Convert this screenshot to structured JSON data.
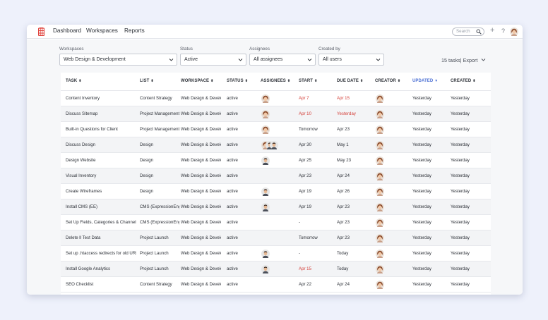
{
  "nav": {
    "items": [
      "Dashboard",
      "Workspaces",
      "Reports"
    ],
    "search_placeholder": "Search"
  },
  "filters": {
    "workspaces": {
      "label": "Workspaces",
      "value": "Web Design & Development"
    },
    "status": {
      "label": "Status",
      "value": "Active"
    },
    "assignees": {
      "label": "Assignees",
      "value": "All assignees"
    },
    "created_by": {
      "label": "Created by",
      "value": "All users"
    }
  },
  "summary": {
    "count_text": "15 tasks| Export"
  },
  "colors": {
    "accent": "#4a6fd4",
    "overdue": "#d4403a",
    "brand": "#e0443e"
  },
  "table": {
    "columns": [
      "TASK",
      "LIST",
      "WORKSPACE",
      "STATUS",
      "ASSIGNEES",
      "START",
      "DUE DATE",
      "CREATOR",
      "UPDATED",
      "CREATED"
    ],
    "sorted_column": "UPDATED",
    "rows": [
      {
        "task": "Content Inventory",
        "list": "Content Strategy",
        "workspace": "Web Design & Develo",
        "status": "active",
        "assignees": [
          "avatar-woman"
        ],
        "start": "Apr 7",
        "start_red": true,
        "due": "Apr 15",
        "due_red": true,
        "creator": "avatar-woman",
        "updated": "Yesterday",
        "created": "Yesterday"
      },
      {
        "task": "Discuss Sitemap",
        "list": "Project Management",
        "workspace": "Web Design & Develo",
        "status": "active",
        "assignees": [
          "avatar-woman"
        ],
        "start": "Apr 10",
        "start_red": true,
        "due": "Yesterday",
        "due_red": true,
        "creator": "avatar-woman",
        "updated": "Yesterday",
        "created": "Yesterday"
      },
      {
        "task": "Built-in Questions for Client",
        "list": "Project Management",
        "workspace": "Web Design & Develo",
        "status": "active",
        "assignees": [
          "avatar-woman"
        ],
        "start": "Tomorrow",
        "start_red": false,
        "due": "Apr 23",
        "due_red": false,
        "creator": "avatar-woman",
        "updated": "Yesterday",
        "created": "Yesterday"
      },
      {
        "task": "Discuss Design",
        "list": "Design",
        "workspace": "Web Design & Develo",
        "status": "active",
        "assignees": [
          "avatar-woman",
          "avatar-man",
          "avatar-man"
        ],
        "start": "Apr 30",
        "start_red": false,
        "due": "May 1",
        "due_red": false,
        "creator": "avatar-woman",
        "updated": "Yesterday",
        "created": "Yesterday"
      },
      {
        "task": "Design Website",
        "list": "Design",
        "workspace": "Web Design & Develo",
        "status": "active",
        "assignees": [
          "avatar-man"
        ],
        "start": "Apr 25",
        "start_red": false,
        "due": "May 23",
        "due_red": false,
        "creator": "avatar-woman",
        "updated": "Yesterday",
        "created": "Yesterday"
      },
      {
        "task": "Visual Inventory",
        "list": "Design",
        "workspace": "Web Design & Develo",
        "status": "active",
        "assignees": [],
        "start": "Apr 23",
        "start_red": false,
        "due": "Apr 24",
        "due_red": false,
        "creator": "avatar-woman",
        "updated": "Yesterday",
        "created": "Yesterday"
      },
      {
        "task": "Create Wireframes",
        "list": "Design",
        "workspace": "Web Design & Develo",
        "status": "active",
        "assignees": [
          "avatar-man"
        ],
        "start": "Apr 19",
        "start_red": false,
        "due": "Apr 26",
        "due_red": false,
        "creator": "avatar-woman",
        "updated": "Yesterday",
        "created": "Yesterday"
      },
      {
        "task": "Install CMS (EE)",
        "list": "CMS (ExpressionEngine)",
        "workspace": "Web Design & Develo",
        "status": "active",
        "assignees": [
          "avatar-man"
        ],
        "start": "Apr 19",
        "start_red": false,
        "due": "Apr 23",
        "due_red": false,
        "creator": "avatar-woman",
        "updated": "Yesterday",
        "created": "Yesterday"
      },
      {
        "task": "Set Up Fields, Categories & Channels",
        "list": "CMS (ExpressionEngine)",
        "workspace": "Web Design & Develo",
        "status": "active",
        "assignees": [],
        "start": "-",
        "start_red": false,
        "due": "Apr 23",
        "due_red": false,
        "creator": "avatar-woman",
        "updated": "Yesterday",
        "created": "Yesterday"
      },
      {
        "task": "Delete ll Test Data",
        "list": "Project Launch",
        "workspace": "Web Design & Develo",
        "status": "active",
        "assignees": [],
        "start": "Tomorrow",
        "start_red": false,
        "due": "Apr 23",
        "due_red": false,
        "creator": "avatar-woman",
        "updated": "Yesterday",
        "created": "Yesterday"
      },
      {
        "task": "Set up .htaccess redirects for old URLs",
        "list": "Project Launch",
        "workspace": "Web Design & Develo",
        "status": "active",
        "assignees": [
          "avatar-man"
        ],
        "start": "-",
        "start_red": false,
        "due": "Today",
        "due_red": false,
        "creator": "avatar-woman",
        "updated": "Yesterday",
        "created": "Yesterday"
      },
      {
        "task": "Install Google Analytics",
        "list": "Project Launch",
        "workspace": "Web Design & Develo",
        "status": "active",
        "assignees": [
          "avatar-man"
        ],
        "start": "Apr 15",
        "start_red": true,
        "due": "Today",
        "due_red": false,
        "creator": "avatar-woman",
        "updated": "Yesterday",
        "created": "Yesterday"
      },
      {
        "task": "SEO Checklist",
        "list": "Content Strategy",
        "workspace": "Web Design & Develo",
        "status": "active",
        "assignees": [],
        "start": "Apr 22",
        "start_red": false,
        "due": "Apr 24",
        "due_red": false,
        "creator": "avatar-woman",
        "updated": "Yesterday",
        "created": "Yesterday"
      }
    ]
  }
}
